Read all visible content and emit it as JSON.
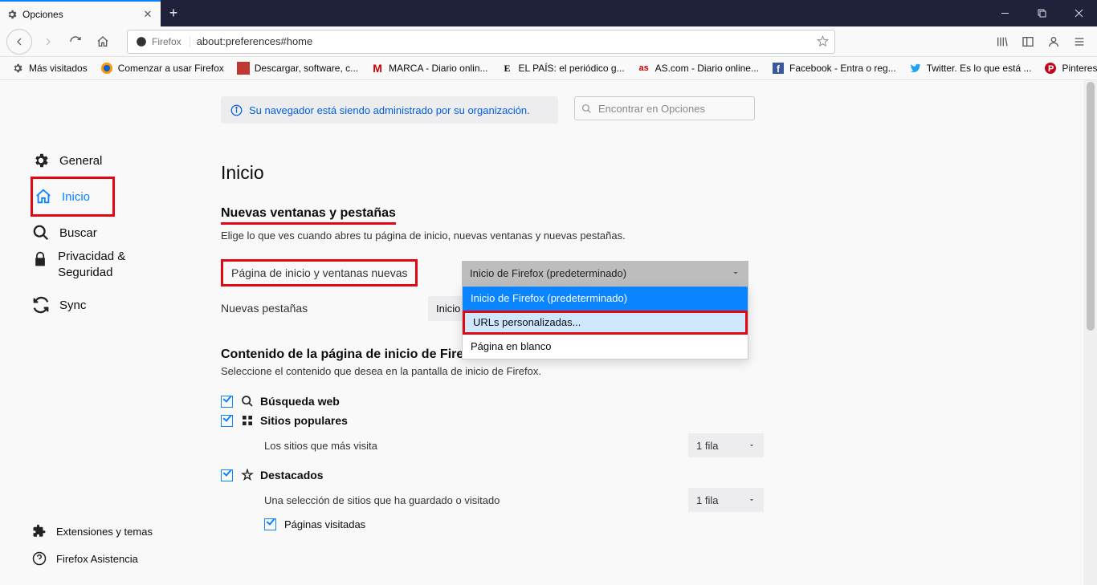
{
  "tab": {
    "title": "Opciones"
  },
  "url": {
    "identity": "Firefox",
    "address": "about:preferences#home"
  },
  "bookmarks": [
    {
      "label": "Más visitados",
      "icon": "star"
    },
    {
      "label": "Comenzar a usar Firefox",
      "icon": "firefox"
    },
    {
      "label": "Descargar, software, c...",
      "icon": "moz"
    },
    {
      "label": "MARCA - Diario onlin...",
      "icon": "marca"
    },
    {
      "label": "EL PAÍS: el periódico g...",
      "icon": "elpais"
    },
    {
      "label": "AS.com - Diario online...",
      "icon": "as"
    },
    {
      "label": "Facebook - Entra o reg...",
      "icon": "fb"
    },
    {
      "label": "Twitter. Es lo que está ...",
      "icon": "tw"
    },
    {
      "label": "Pinterest",
      "icon": "pin"
    }
  ],
  "sidebar": {
    "items": [
      {
        "label": "General"
      },
      {
        "label": "Inicio"
      },
      {
        "label": "Buscar"
      },
      {
        "label": "Privacidad & Seguridad"
      },
      {
        "label": "Sync"
      }
    ],
    "footer": [
      {
        "label": "Extensiones y temas"
      },
      {
        "label": "Firefox Asistencia"
      }
    ]
  },
  "banner": {
    "text": "Su navegador está siendo administrado por su organización."
  },
  "search": {
    "placeholder": "Encontrar en Opciones"
  },
  "page": {
    "title": "Inicio",
    "section1": {
      "heading": "Nuevas ventanas y pestañas",
      "sub": "Elige lo que ves cuando abres tu página de inicio, nuevas ventanas y nuevas pestañas.",
      "row1": {
        "label": "Página de inicio y ventanas nuevas",
        "selected": "Inicio de Firefox (predeterminado)"
      },
      "row2": {
        "label": "Nuevas pestañas",
        "selected_prefix": "Inicio"
      },
      "options": [
        "Inicio de Firefox (predeterminado)",
        "URLs personalizadas...",
        "Página en blanco"
      ]
    },
    "section2": {
      "heading": "Contenido de la página de inicio de Firefox",
      "sub": "Seleccione el contenido que desea en la pantalla de inicio de Firefox.",
      "chk1": "Búsqueda web",
      "chk2": "Sitios populares",
      "chk2_sub": "Los sitios que más visita",
      "chk2_sel": "1 fila",
      "chk3": "Destacados",
      "chk3_sub": "Una selección de sitios que ha guardado o visitado",
      "chk3_sel": "1 fila",
      "chk3b": "Páginas visitadas"
    }
  }
}
